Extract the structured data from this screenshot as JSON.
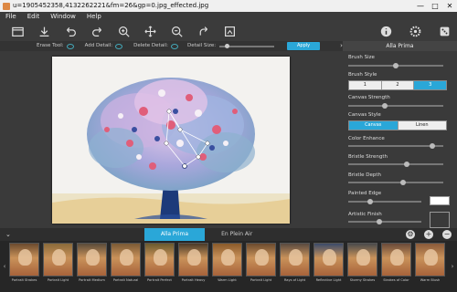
{
  "window": {
    "title": "u=1905452358,4132262221&fm=26&gp=0.jpg_effected.jpg",
    "min": "—",
    "max": "□",
    "close": "✕"
  },
  "menu": [
    "File",
    "Edit",
    "Window",
    "Help"
  ],
  "toolbar": {
    "left_icons": [
      "open-icon",
      "save-icon",
      "undo-icon",
      "redo-icon",
      "zoom-in-icon",
      "pan-icon",
      "zoom-out-icon",
      "rotate-icon",
      "crop-icon"
    ],
    "right_icons": [
      "info-icon",
      "settings-icon",
      "dice-icon"
    ]
  },
  "options": {
    "erase_tool": "Erase Tool:",
    "add_detail": "Add Detail:",
    "delete_detail": "Delete Detail:",
    "detail_size": "Detail Size:",
    "apply": "Apply",
    "expand": "›"
  },
  "panel": {
    "title": "Alla Prima",
    "brush_size": "Brush Size",
    "brush_style": "Brush Style",
    "brush_style_options": [
      "1",
      "2",
      "3"
    ],
    "brush_style_selected": 2,
    "canvas_strength": "Canvas Strength",
    "canvas_style": "Canvas Style",
    "canvas_style_options": [
      "Canvas",
      "Linen"
    ],
    "canvas_style_selected": 0,
    "color_enhance": "Color Enhance",
    "bristle_strength": "Bristle Strength",
    "bristle_depth": "Bristle Depth",
    "painted_edge": "Painted Edge",
    "artistic_finish": "Artistic Finish",
    "levels": {
      "brush_size": 0.5,
      "canvas_strength": 0.38,
      "color_enhance": 0.88,
      "bristle_strength": 0.62,
      "bristle_depth": 0.58,
      "painted_edge": 0.3,
      "artistic_finish": 0.42
    }
  },
  "tabs": {
    "active": "Alla Prima",
    "other": "En Plein Air",
    "collapse": "⌄"
  },
  "presets": {
    "prev": "‹",
    "next": "›",
    "items": [
      "Portrait Strokes",
      "Portrait Light",
      "Portrait Medium",
      "Portrait Natural",
      "Portrait Perfect",
      "Portrait Heavy",
      "Warm Light",
      "Portrait Light",
      "Rays of Light",
      "Reflective Light",
      "Stormy Strokes",
      "Strokes of Color",
      "Warm Blush"
    ]
  },
  "colors": {
    "accent": "#2aa7d8",
    "panel_bg": "#3a3a3a",
    "toolbar_bg": "#3b3b3b"
  }
}
